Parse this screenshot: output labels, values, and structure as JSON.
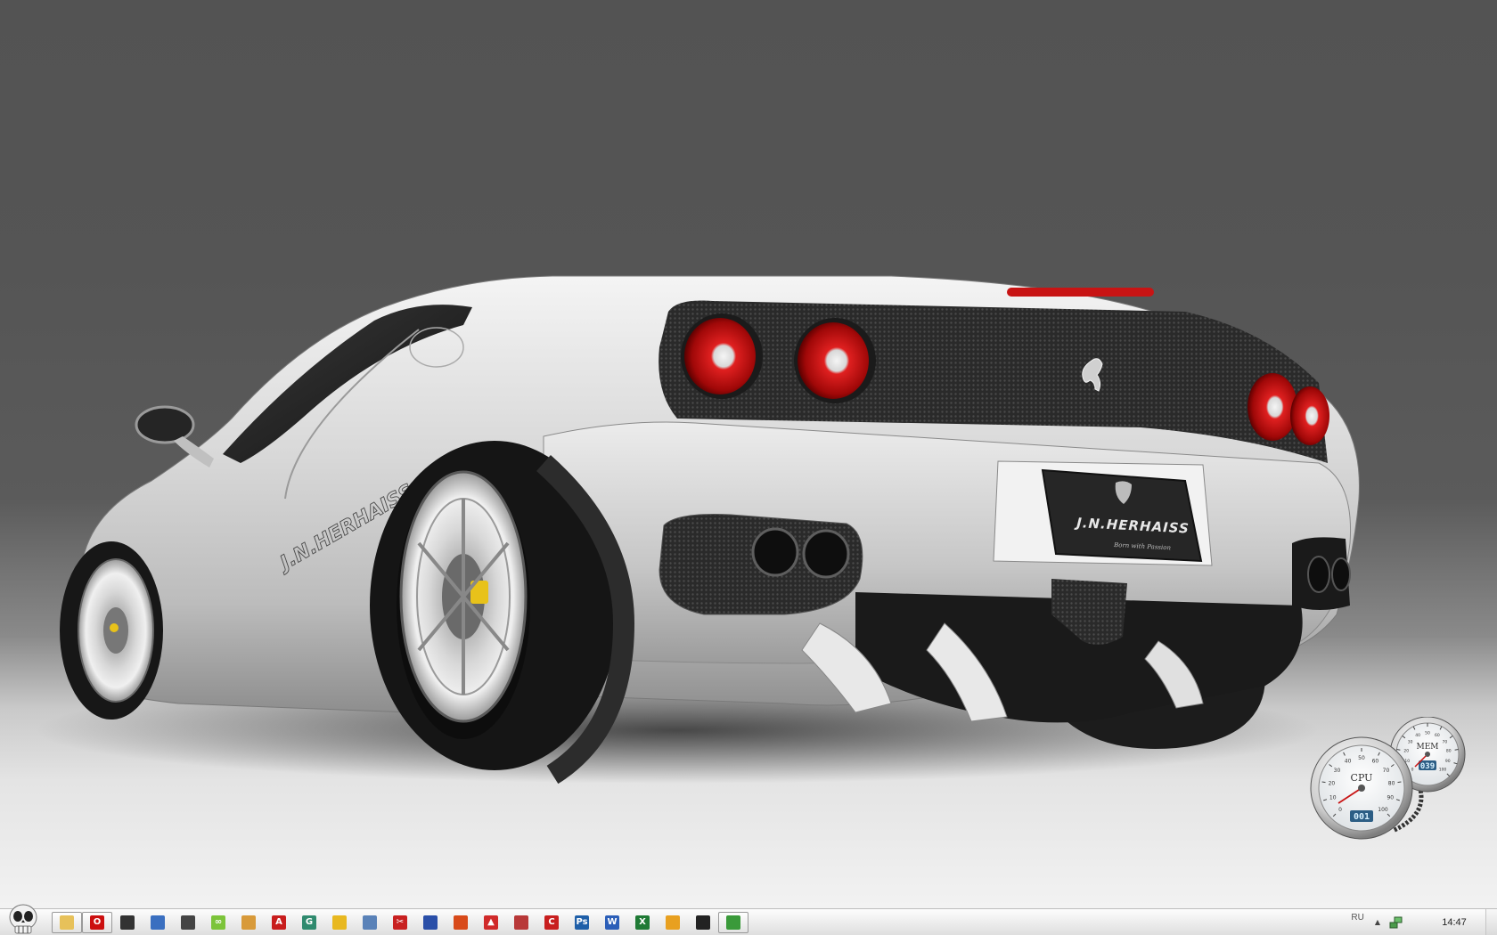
{
  "wallpaper": {
    "plate_brand": "J.N.HERHAISS",
    "plate_slogan": "Born with Passion",
    "side_decal": "J.N.HERHAISS"
  },
  "gadget": {
    "cpu_label": "CPU",
    "cpu_value": "001",
    "mem_label": "MEM",
    "mem_value": "039",
    "cpu_ticks": [
      "0",
      "10",
      "20",
      "30",
      "40",
      "50",
      "60",
      "70",
      "80",
      "90",
      "100"
    ],
    "mem_ticks": [
      "0",
      "10",
      "20",
      "30",
      "40",
      "50",
      "60",
      "70",
      "80",
      "90",
      "100"
    ]
  },
  "taskbar": {
    "start_icon": "skull-icon",
    "quick_launch": [
      {
        "icon": "folder-icon",
        "name": "ql-explorer",
        "glyph": "",
        "color": "#e7c15a",
        "active": true
      },
      {
        "icon": "opera-icon",
        "name": "ql-opera",
        "glyph": "O",
        "color": "#cc1010",
        "active": true
      },
      {
        "icon": "film-icon",
        "name": "ql-media",
        "glyph": "",
        "color": "#333333",
        "active": false
      },
      {
        "icon": "network-icon",
        "name": "ql-network",
        "glyph": "",
        "color": "#3a6fc0",
        "active": false
      },
      {
        "icon": "shield-icon",
        "name": "ql-shield",
        "glyph": "",
        "color": "#444444",
        "active": false
      },
      {
        "icon": "infinity-icon",
        "name": "ql-infinity",
        "glyph": "∞",
        "color": "#7cc43a",
        "active": false
      },
      {
        "icon": "chat-icon",
        "name": "ql-chat",
        "glyph": "",
        "color": "#d89a3a",
        "active": false
      },
      {
        "icon": "acrobat-icon",
        "name": "ql-acrobat",
        "glyph": "A",
        "color": "#c81d1d",
        "active": false
      },
      {
        "icon": "globe-icon",
        "name": "ql-globe",
        "glyph": "G",
        "color": "#2f8a6e",
        "active": false
      },
      {
        "icon": "pen-icon",
        "name": "ql-pen",
        "glyph": "",
        "color": "#e8b820",
        "active": false
      },
      {
        "icon": "person-icon",
        "name": "ql-person",
        "glyph": "",
        "color": "#5a82b8",
        "active": false
      },
      {
        "icon": "scissors-icon",
        "name": "ql-cut",
        "glyph": "✂",
        "color": "#c82020",
        "active": false
      },
      {
        "icon": "disk-icon",
        "name": "ql-disk",
        "glyph": "",
        "color": "#2a4fa8",
        "active": false
      },
      {
        "icon": "flame-icon",
        "name": "ql-flame",
        "glyph": "",
        "color": "#d84a1a",
        "active": false
      },
      {
        "icon": "triangle-icon",
        "name": "ql-triangle",
        "glyph": "▲",
        "color": "#d02a2a",
        "active": false
      },
      {
        "icon": "record-icon",
        "name": "ql-record",
        "glyph": "",
        "color": "#b83838",
        "active": false
      },
      {
        "icon": "cycle-icon",
        "name": "ql-cycle",
        "glyph": "C",
        "color": "#c81e1e",
        "active": false
      },
      {
        "icon": "photoshop-icon",
        "name": "ql-photoshop",
        "glyph": "Ps",
        "color": "#1f5fa8",
        "active": false
      },
      {
        "icon": "word-icon",
        "name": "ql-word",
        "glyph": "W",
        "color": "#2c5fb8",
        "active": false
      },
      {
        "icon": "excel-icon",
        "name": "ql-excel",
        "glyph": "X",
        "color": "#1f7a35",
        "active": false
      },
      {
        "icon": "warning-icon",
        "name": "ql-warning",
        "glyph": "",
        "color": "#e8a020",
        "active": false
      },
      {
        "icon": "game-icon",
        "name": "ql-game",
        "glyph": "",
        "color": "#222222",
        "active": false
      },
      {
        "icon": "notepad-icon",
        "name": "ql-notepad",
        "glyph": "",
        "color": "#3a9a3a",
        "active": true
      }
    ],
    "tray": {
      "language": "RU",
      "clock": "14:47"
    }
  }
}
